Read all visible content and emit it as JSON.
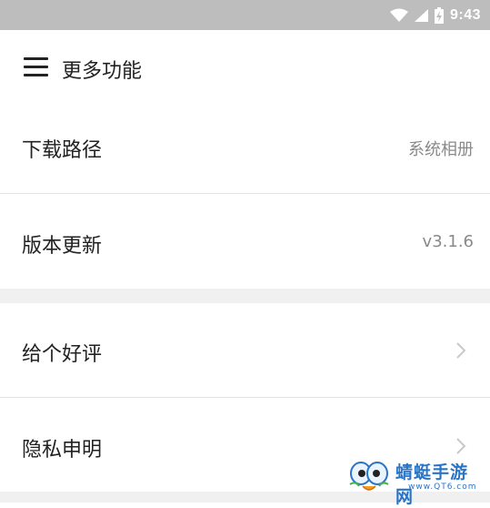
{
  "status_bar": {
    "time": "9:43",
    "icons": [
      "wifi-icon",
      "signal-icon",
      "battery-charging-icon"
    ]
  },
  "header": {
    "menu_icon": "hamburger-menu-icon",
    "title": "更多功能"
  },
  "settings": {
    "group1": [
      {
        "label": "下载路径",
        "value": "系统相册"
      },
      {
        "label": "版本更新",
        "value": "v3.1.6"
      }
    ],
    "group2": [
      {
        "label": "给个好评",
        "icon": "chevron-right-icon"
      },
      {
        "label": "隐私申明",
        "icon": "chevron-right-icon"
      }
    ]
  },
  "watermark": {
    "name": "蜻蜓手游网",
    "url": "www.QT6.com"
  },
  "colors": {
    "status_bar_bg": "#bdbdbd",
    "section_gap": "#f0f0f0",
    "secondary_text": "#8a8a8a",
    "watermark_blue": "#2a74c7"
  }
}
